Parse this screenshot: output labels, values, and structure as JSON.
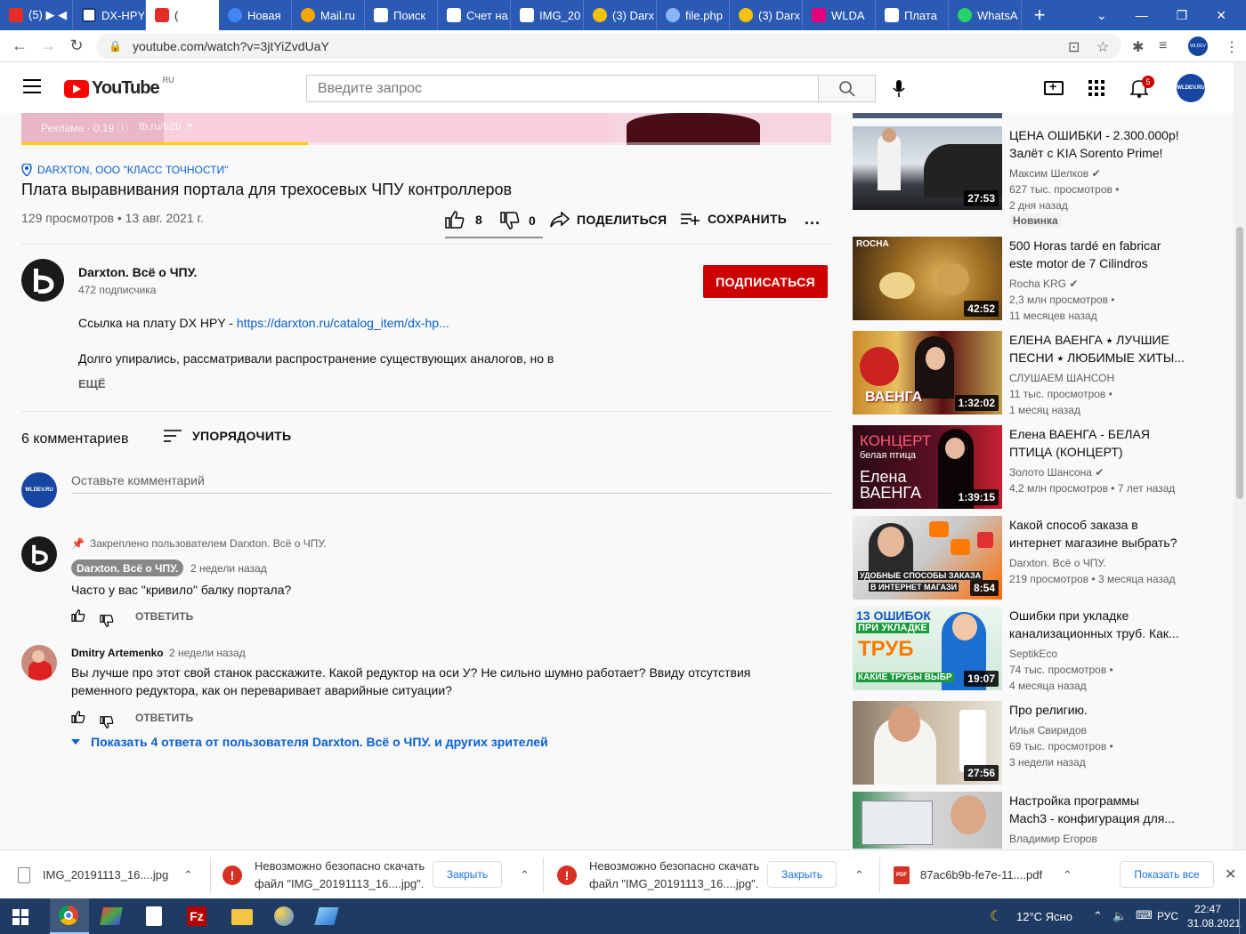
{
  "browser": {
    "tabs": [
      {
        "label": "(5) ▶ ◀",
        "favicon_color": "#e52d27"
      },
      {
        "label": "DX-HPY",
        "favicon_color": "#1d3b7a"
      },
      {
        "label": "(",
        "favicon_color": "#e52d27"
      },
      {
        "label": "Новая",
        "favicon_color": "#4285f4"
      },
      {
        "label": "Mail.ru",
        "favicon_color": "#f7a600"
      },
      {
        "label": "Поиск",
        "favicon_color": "#1a73e8"
      },
      {
        "label": "Счет на",
        "favicon_color": "#1a73e8"
      },
      {
        "label": "IMG_20",
        "favicon_color": "#1a73e8"
      },
      {
        "label": "(3) Darx",
        "favicon_color": "#f4c20d"
      },
      {
        "label": "file.php",
        "favicon_color": "#1a73e8"
      },
      {
        "label": "(3) Darx",
        "favicon_color": "#f4c20d"
      },
      {
        "label": "WLDA",
        "favicon_color": "#e4007c"
      },
      {
        "label": "Плата",
        "favicon_color": "#0f3e7f"
      },
      {
        "label": "WhatsA",
        "favicon_color": "#25d366"
      }
    ],
    "url": "youtube.com/watch?v=3jtYiZvdUaY",
    "new_tab": "+"
  },
  "yt_header": {
    "logo": "YouTube",
    "region": "RU",
    "search_placeholder": "Введите запрос",
    "notifications_count": "5",
    "avatar_text": "WLDEV.RU"
  },
  "player": {
    "ad_text": "Реклама · 0:19 ⓘ",
    "ad_link": "fb.ru/b2b ↗"
  },
  "video": {
    "location": "DARXTON, ООО \"КЛАСС ТОЧНОСТИ\"",
    "title": "Плата выравнивания портала для трехосевых ЧПУ контроллеров",
    "views_date": "129 просмотров • 13 авг. 2021 г.",
    "likes": "8",
    "dislikes": "0",
    "share": "ПОДЕЛИТЬСЯ",
    "save": "СОХРАНИТЬ",
    "more": "..."
  },
  "channel": {
    "name": "Darxton. Всё о ЧПУ.",
    "subscribers": "472 подписчика",
    "subscribe": "ПОДПИСАТЬСЯ",
    "desc_prefix": "Ссылка на плату DX HPY - ",
    "desc_link": "https://darxton.ru/catalog_item/dx-hp...",
    "desc_line2": "Долго упирались, рассматривали распространение существующих аналогов, но в",
    "more": "ЕЩЁ"
  },
  "comments": {
    "count": "6 комментариев",
    "sort": "УПОРЯДОЧИТЬ",
    "add_placeholder": "Оставьте комментарий",
    "my_avatar": "WLDEV.RU",
    "items": [
      {
        "pinned": "Закреплено пользователем Darxton. Всё о ЧПУ.",
        "author": "Darxton. Всё о ЧПУ.",
        "time": "2 недели назад",
        "text": "Часто у вас \"кривило\" балку портала?",
        "reply": "ОТВЕТИТЬ"
      },
      {
        "author": "Dmitry Artemenko",
        "time": "2 недели назад",
        "text1": "Вы лучше про этот свой станок расскажите. Какой редуктор на оси У? Не сильно шумно работает? Ввиду отсутствия",
        "text2": "ременного редуктора, как он переваривает аварийные ситуации?",
        "reply": "ОТВЕТИТЬ",
        "show_replies": "Показать 4 ответа от пользователя Darxton. Всё о ЧПУ. и других зрителей"
      }
    ]
  },
  "recommendations": [
    {
      "title1": "ЦЕНА ОШИБКИ - 2.300.000р!",
      "title2": "Залёт с KIA Sorento Prime!",
      "channel": "Максим Шелков",
      "verified": true,
      "views": "627 тыс. просмотров •",
      "age": "2 дня назад",
      "badge": "Новинка",
      "duration": "27:53"
    },
    {
      "title1": "500 Horas tardé en fabricar",
      "title2": "este motor de 7 Cilindros",
      "channel": "Rocha KRG",
      "verified": true,
      "views": "2,3 млн просмотров •",
      "age": "11 месяцев назад",
      "duration": "42:52",
      "thumb_text": "ROCHA"
    },
    {
      "title1": "ЕЛЕНА ВАЕНГА ⭑ ЛУЧШИЕ",
      "title2": "ПЕСНИ ⭑ ЛЮБИМЫЕ ХИТЫ...",
      "channel": "СЛУШАЕМ ШАНСОН",
      "verified": false,
      "views": "11 тыс. просмотров •",
      "age": "1 месяц назад",
      "duration": "1:32:02",
      "thumb_text": "ВАЕНГА"
    },
    {
      "title1": "Елена ВАЕНГА - БЕЛАЯ",
      "title2": "ПТИЦА (КОНЦЕРТ)",
      "channel": "Золото Шансона",
      "verified": true,
      "views": "4,2 млн просмотров • 7 лет назад",
      "age": "",
      "duration": "1:39:15",
      "thumb_text1": "КОНЦЕРТ",
      "thumb_text2": "белая птица",
      "thumb_text3": "Елена",
      "thumb_text4": "ВАЕНГА"
    },
    {
      "title1": "Какой способ заказа в",
      "title2": "интернет магазине выбрать?",
      "channel": "Darxton. Всё о ЧПУ.",
      "verified": false,
      "views": "219 просмотров • 3 месяца назад",
      "age": "",
      "duration": "8:54",
      "thumb_text1": "УДОБНЫЕ СПОСОБЫ ЗАКАЗА",
      "thumb_text2": "В ИНТЕРНЕТ МАГАЗИ"
    },
    {
      "title1": "Ошибки при укладке",
      "title2": "канализационных труб. Как...",
      "channel": "SeptikEco",
      "verified": false,
      "views": "74 тыс. просмотров •",
      "age": "4 месяца назад",
      "duration": "19:07",
      "thumb_text1": "13 ОШИБОК",
      "thumb_text2": "ПРИ УКЛАДКЕ",
      "thumb_text3": "ТРУБ",
      "thumb_text4": "КАКИЕ ТРУБЫ ВЫБР"
    },
    {
      "title1": "Про религию.",
      "title2": "",
      "channel": "Илья Свиридов",
      "verified": false,
      "views": "69 тыс. просмотров •",
      "age": "3 недели назад",
      "duration": "27:56"
    },
    {
      "title1": "Настройка программы",
      "title2": "Mach3 - конфигурация для...",
      "channel": "Владимир Егоров",
      "verified": false,
      "views": "",
      "age": "",
      "duration": ""
    }
  ],
  "downloads": [
    {
      "name": "IMG_20191113_16....jpg"
    },
    {
      "error1": "Невозможно безопасно скачать",
      "error2": "файл \"IMG_20191113_16....jpg\".",
      "close": "Закрыть"
    },
    {
      "error1": "Невозможно безопасно скачать",
      "error2": "файл \"IMG_20191113_16....jpg\".",
      "close": "Закрыть"
    },
    {
      "name": "87ac6b9b-fe7e-11....pdf"
    }
  ],
  "downloads_show_all": "Показать все",
  "taskbar": {
    "weather": "12°C  Ясно",
    "lang": "РУС",
    "time": "22:47",
    "date": "31.08.2021"
  }
}
